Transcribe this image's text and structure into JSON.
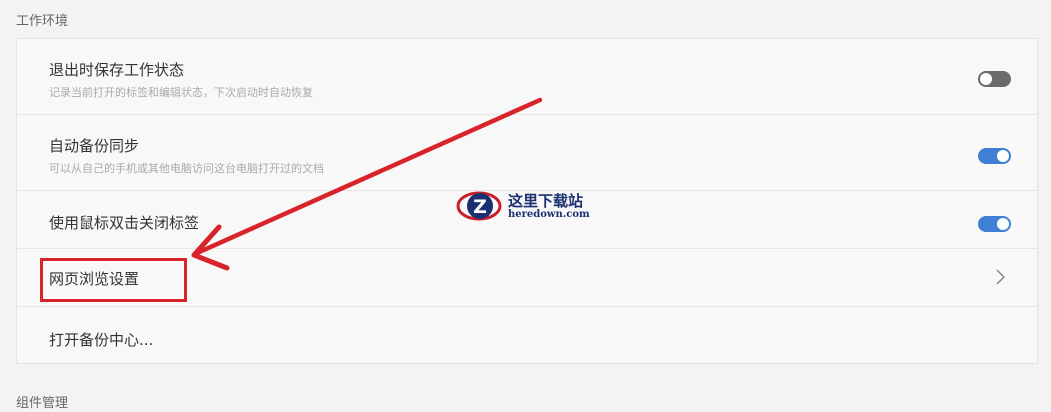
{
  "sections": {
    "workspace": "工作环境",
    "components": "组件管理"
  },
  "settings": [
    {
      "title": "退出时保存工作状态",
      "desc": "记录当前打开的标签和编辑状态，下次启动时自动恢复",
      "toggle": "off"
    },
    {
      "title": "自动备份同步",
      "desc": "可以从自己的手机或其他电脑访问这台电脑打开过的文档",
      "toggle": "on"
    },
    {
      "title": "使用鼠标双击关闭标签",
      "toggle": "on"
    },
    {
      "title": "网页浏览设置"
    },
    {
      "title": "打开备份中心..."
    }
  ],
  "watermark": {
    "logo_letter": "Z",
    "name": "这里下载站",
    "domain": "heredown.com"
  },
  "colors": {
    "accent": "#3f7fd4",
    "toggle_off": "#6b6b6b",
    "annotation": "#d8232a"
  }
}
